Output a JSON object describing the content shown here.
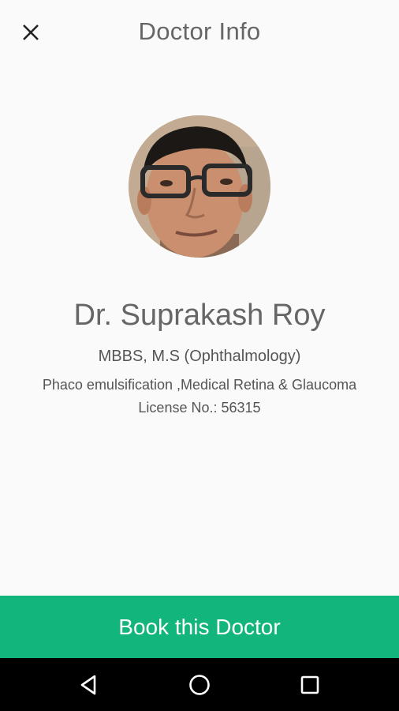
{
  "header": {
    "title": "Doctor Info",
    "close_icon": "close-icon"
  },
  "doctor": {
    "name": "Dr. Suprakash Roy",
    "degree": "MBBS, M.S (Ophthalmology)",
    "specialty": "Phaco emulsification ,Medical Retina & Glaucoma",
    "license_label": "License No.:",
    "license_number": "56315",
    "avatar_icon": "doctor-photo"
  },
  "actions": {
    "book_label": "Book this Doctor",
    "book_color": "#12b57b"
  },
  "system_nav": {
    "back_icon": "back-triangle-icon",
    "home_icon": "home-circle-icon",
    "recents_icon": "recents-square-icon"
  }
}
